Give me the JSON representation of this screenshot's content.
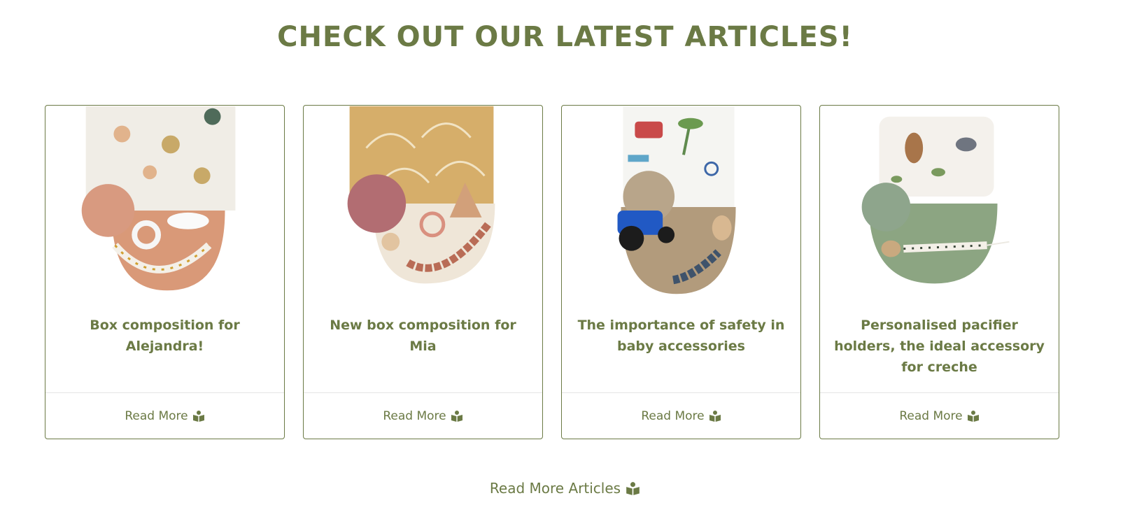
{
  "section": {
    "title": "CHECK OUT OUR LATEST ARTICLES!"
  },
  "articles": [
    {
      "title": "Box composition for Alejandra!",
      "read_more": "Read More",
      "image": "pacifier-set-peach"
    },
    {
      "title": "New box composition for Mia",
      "read_more": "Read More",
      "image": "pacifier-set-mustard"
    },
    {
      "title": "The importance of safety in baby accessories",
      "read_more": "Read More",
      "image": "pacifier-set-beige"
    },
    {
      "title": "Personalised pacifier holders, the ideal accessory for creche",
      "read_more": "Read More",
      "image": "pacifier-set-sage"
    }
  ],
  "footer": {
    "more_label": "Read More Articles",
    "icon": "book-reader-icon"
  },
  "colors": {
    "accent": "#6b7a45",
    "border": "#6b7a45",
    "divider": "#e4e4e4"
  }
}
